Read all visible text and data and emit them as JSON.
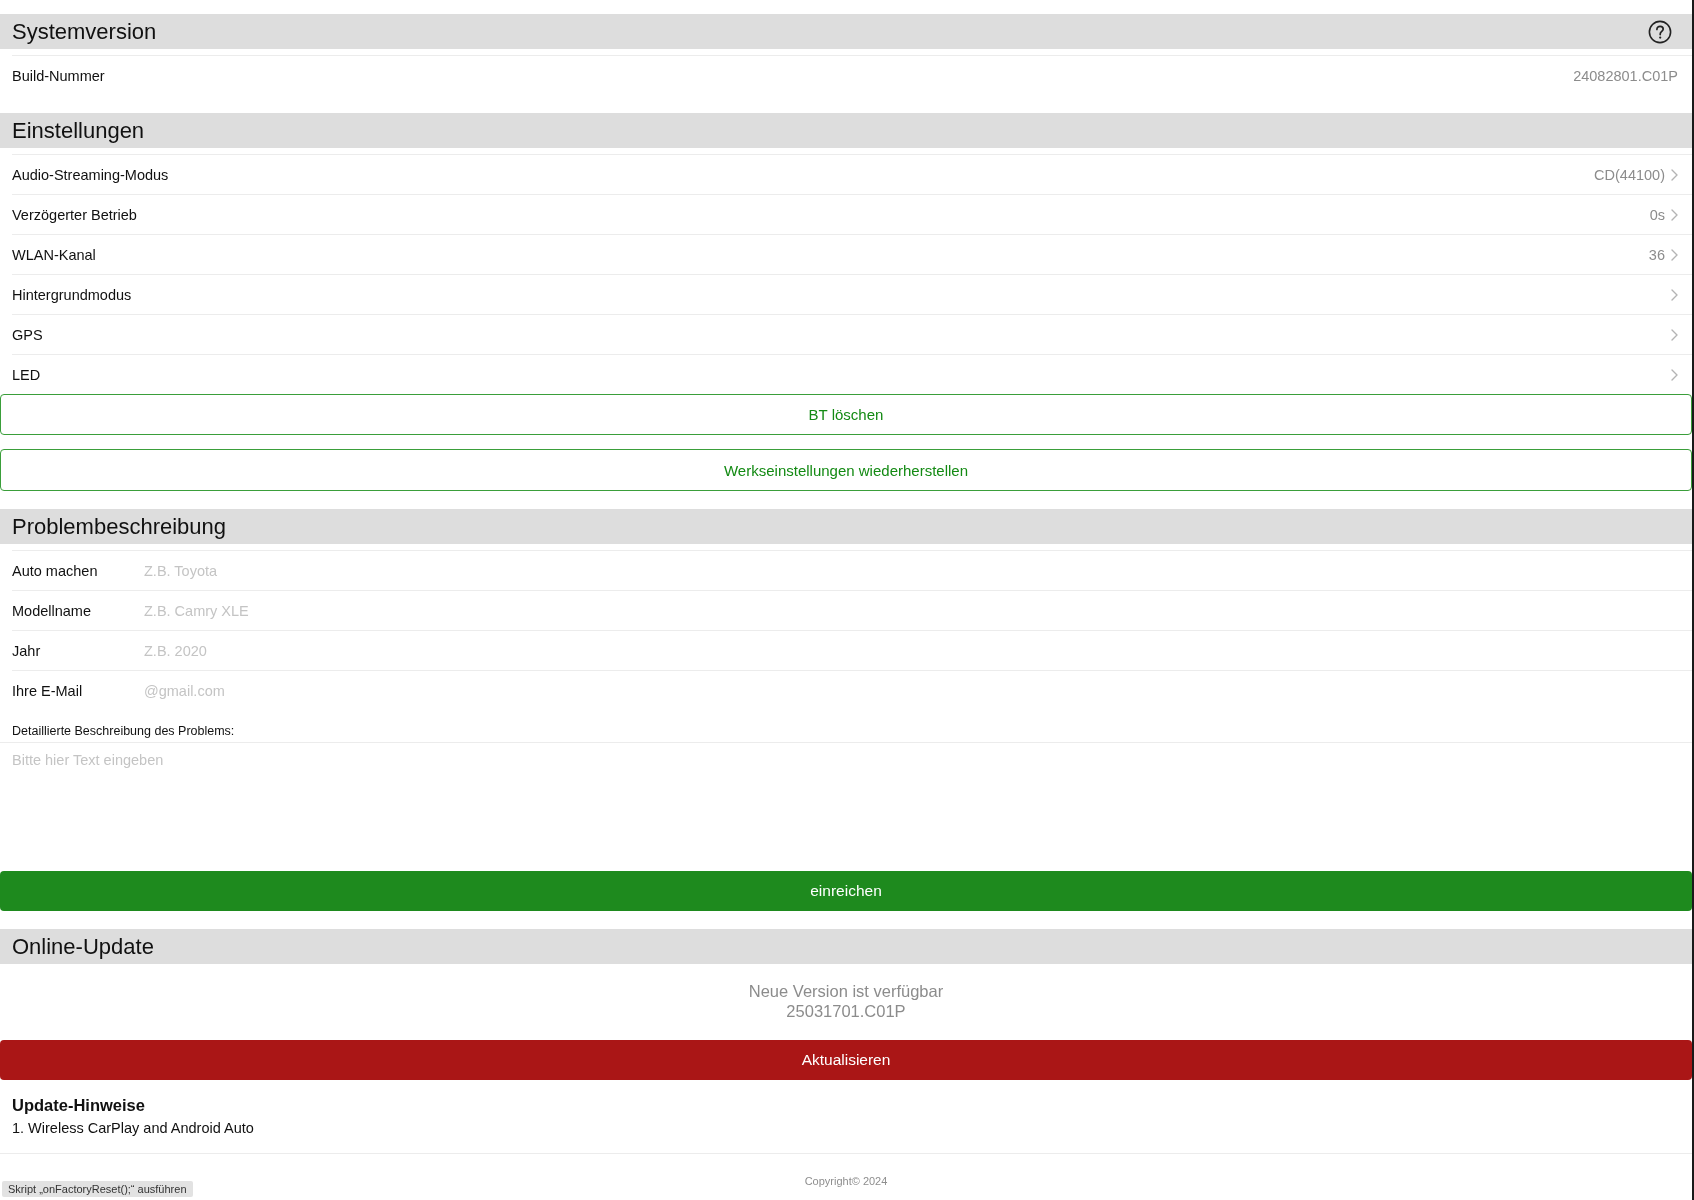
{
  "system_version": {
    "title": "Systemversion",
    "rows": [
      {
        "label": "Build-Nummer",
        "value": "24082801.C01P"
      }
    ]
  },
  "settings": {
    "title": "Einstellungen",
    "rows": [
      {
        "label": "Audio-Streaming-Modus",
        "value": "CD(44100)"
      },
      {
        "label": "Verzögerter Betrieb",
        "value": "0s"
      },
      {
        "label": "WLAN-Kanal",
        "value": "36"
      },
      {
        "label": "Hintergrundmodus"
      },
      {
        "label": "GPS"
      },
      {
        "label": "LED"
      }
    ],
    "buttons": [
      "BT löschen",
      "Werkseinstellungen wiederherstellen"
    ]
  },
  "problem": {
    "title": "Problembeschreibung",
    "fields": [
      {
        "label": "Auto machen",
        "placeholder": "Z.B. Toyota"
      },
      {
        "label": "Modellname",
        "placeholder": "Z.B. Camry XLE"
      },
      {
        "label": "Jahr",
        "placeholder": "Z.B. 2020"
      },
      {
        "label": "Ihre E-Mail",
        "placeholder": "@gmail.com"
      }
    ],
    "description": {
      "label": "Detaillierte Beschreibung des Problems:",
      "placeholder": "Bitte hier Text eingeben"
    },
    "submit": "einreichen"
  },
  "online_update": {
    "title": "Online-Update",
    "status": "Neue Version ist verfügbar",
    "version": "25031701.C01P",
    "button": "Aktualisieren",
    "notes_title": "Update-Hinweise",
    "notes": [
      "1. Wireless CarPlay and Android Auto"
    ]
  },
  "footer": {
    "copyright": "Copyright© 2024"
  },
  "status_bar": {
    "text": "Skript „onFactoryReset();“ ausführen"
  }
}
